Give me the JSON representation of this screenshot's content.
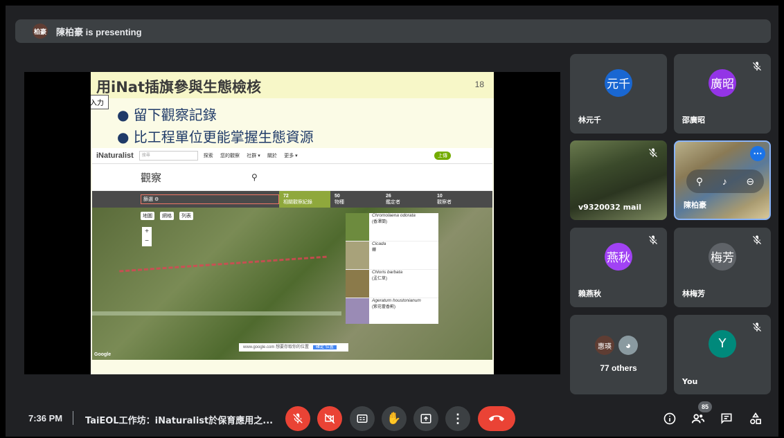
{
  "banner": {
    "presenter_initials": "柏豪",
    "text": "陳柏豪 is presenting"
  },
  "slide": {
    "title": "用iNat插旗參與生態檢核",
    "page_number": "18",
    "tooltip": "檢索語句を入力",
    "bullets": [
      "● 留下觀察記錄",
      "● 比工程單位更能掌握生態資源"
    ],
    "inat": {
      "logo": "iNaturalist",
      "search_placeholder": "搜尋",
      "nav": [
        "探索",
        "您的觀察",
        "社群 ▾",
        "關於",
        "更多 ▾"
      ],
      "upload": "上傳",
      "page_title": "觀察",
      "filter_btn": "篩選 ⚙",
      "tabs": [
        {
          "count": "72",
          "label": "相關觀察紀錄"
        },
        {
          "count": "50",
          "label": "物種"
        },
        {
          "count": "26",
          "label": "鑑定者"
        },
        {
          "count": "10",
          "label": "觀察者"
        }
      ],
      "map_buttons": [
        "地圖",
        "網格",
        "列表"
      ],
      "species": [
        {
          "name": "Chromolaena odorata",
          "sub": "(香澤蘭)"
        },
        {
          "name": "Cicada",
          "sub": "蟬"
        },
        {
          "name": "Chloris barbata",
          "sub": "(孟仁草)"
        },
        {
          "name": "Ageratum houstonianum",
          "sub": "(紫花藿香薊)"
        }
      ],
      "google_label": "Google",
      "map_note": "www.google.com 想要存取你的位置",
      "map_ok": "確定 位置"
    }
  },
  "participants": [
    {
      "initials": "元千",
      "name": "林元千",
      "color": "#1967d2",
      "muted": false
    },
    {
      "initials": "廣昭",
      "name": "邵廣昭",
      "color": "#9334e6",
      "muted": true
    },
    {
      "name": "v9320032 mail",
      "video": true,
      "muted": true
    },
    {
      "name": "陳柏豪",
      "video": true,
      "active": true
    },
    {
      "initials": "燕秋",
      "name": "賴燕秋",
      "color": "#a142f4",
      "muted": true
    },
    {
      "initials": "梅芳",
      "name": "林梅芳",
      "color": "#5f6368",
      "muted": true
    },
    {
      "initials": "Y",
      "name": "You",
      "color": "#00897b",
      "muted": true
    }
  ],
  "others": {
    "avatar_label": "惠瑛",
    "count_label": "77 others"
  },
  "bottom": {
    "time": "7:36 PM",
    "meeting_title": "TaiEOL工作坊：iNaturalist於保育應用之...",
    "participant_count": "85"
  }
}
